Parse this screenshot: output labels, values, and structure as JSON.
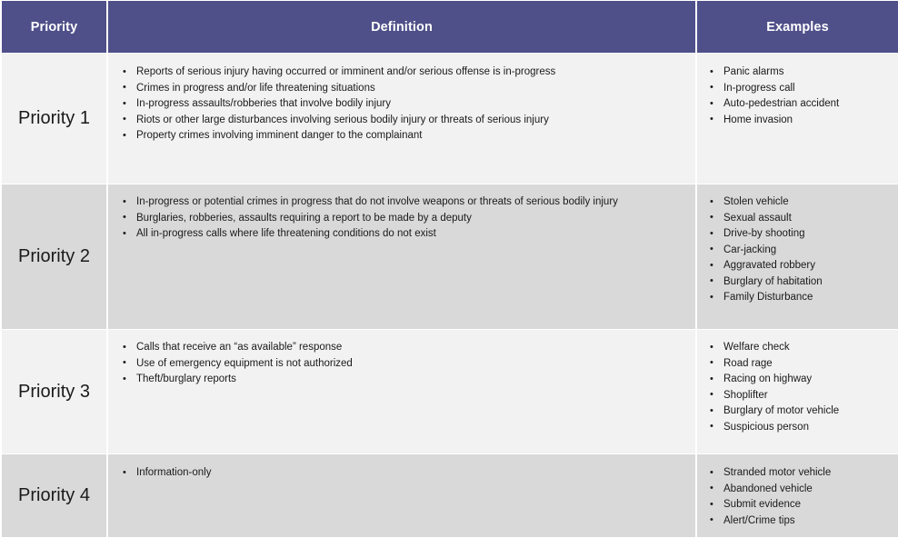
{
  "table": {
    "columns": [
      {
        "key": "priority",
        "label": "Priority"
      },
      {
        "key": "definition",
        "label": "Definition"
      },
      {
        "key": "examples",
        "label": "Examples"
      }
    ],
    "header_bg": "#4f4f8a",
    "header_text_color": "#ffffff",
    "row_bg_light": "#f2f2f2",
    "row_bg_dark": "#d9d9d9",
    "body_text_color": "#1a1a1a",
    "rows": [
      {
        "priority": "Priority 1",
        "definition": [
          "Reports of serious injury having occurred or imminent and/or serious offense is in-progress",
          "Crimes in progress and/or life threatening situations",
          "In-progress assaults/robberies that involve bodily injury",
          "Riots or other large disturbances involving serious bodily injury or threats of serious injury",
          "Property crimes involving imminent danger to the complainant"
        ],
        "examples": [
          "Panic alarms",
          "In-progress call",
          "Auto-pedestrian accident",
          "Home invasion"
        ]
      },
      {
        "priority": "Priority 2",
        "definition": [
          "In-progress or potential crimes in progress that do not involve weapons or threats of serious bodily injury",
          "Burglaries, robberies, assaults requiring a report to be made by a deputy",
          "All in-progress calls where life threatening conditions do not exist"
        ],
        "examples": [
          "Stolen vehicle",
          "Sexual assault",
          "Drive-by shooting",
          "Car-jacking",
          "Aggravated robbery",
          "Burglary of habitation",
          "Family Disturbance"
        ]
      },
      {
        "priority": "Priority 3",
        "definition": [
          "Calls that receive an “as available” response",
          "Use of emergency equipment is not authorized",
          "Theft/burglary reports"
        ],
        "examples": [
          "Welfare check",
          "Road rage",
          "Racing on highway",
          "Shoplifter",
          "Burglary of motor vehicle",
          "Suspicious person"
        ]
      },
      {
        "priority": "Priority 4",
        "definition": [
          "Information-only"
        ],
        "examples": [
          "Stranded motor vehicle",
          "Abandoned vehicle",
          "Submit evidence",
          "Alert/Crime tips"
        ]
      }
    ]
  }
}
